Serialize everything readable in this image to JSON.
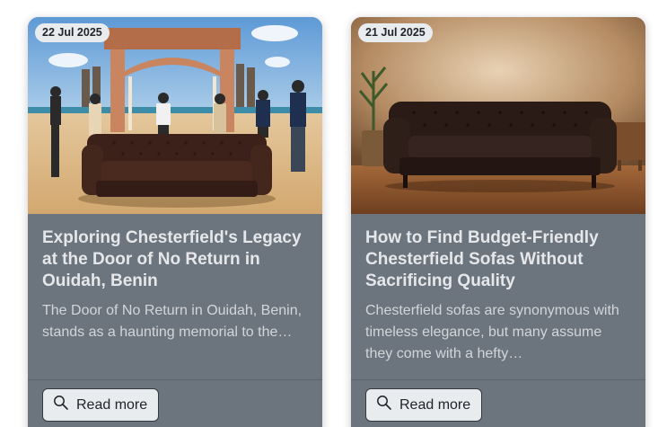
{
  "posts": [
    {
      "date": "22 Jul 2025",
      "title": "Exploring Chesterfield's Legacy at the Door of No Return in Ouidah, Benin",
      "excerpt": "The Door of No Return in Ouidah, Benin, stands as a haunting memorial to the…",
      "read_more_label": "Read more",
      "image_icon": "chesterfield-sofa-door-of-no-return-photo"
    },
    {
      "date": "21 Jul 2025",
      "title": "How to Find Budget-Friendly Chesterfield Sofas Without Sacrificing Quality",
      "excerpt": "Chesterfield sofas are synonymous with timeless elegance, but many assume they come with a hefty…",
      "read_more_label": "Read more",
      "image_icon": "chesterfield-sofa-living-room-photo"
    }
  ],
  "colors": {
    "card_background": "#6c757d",
    "badge_background": "#e9ecef",
    "button_background": "#e9ecef"
  },
  "icons": {
    "read_more": "search-icon"
  }
}
